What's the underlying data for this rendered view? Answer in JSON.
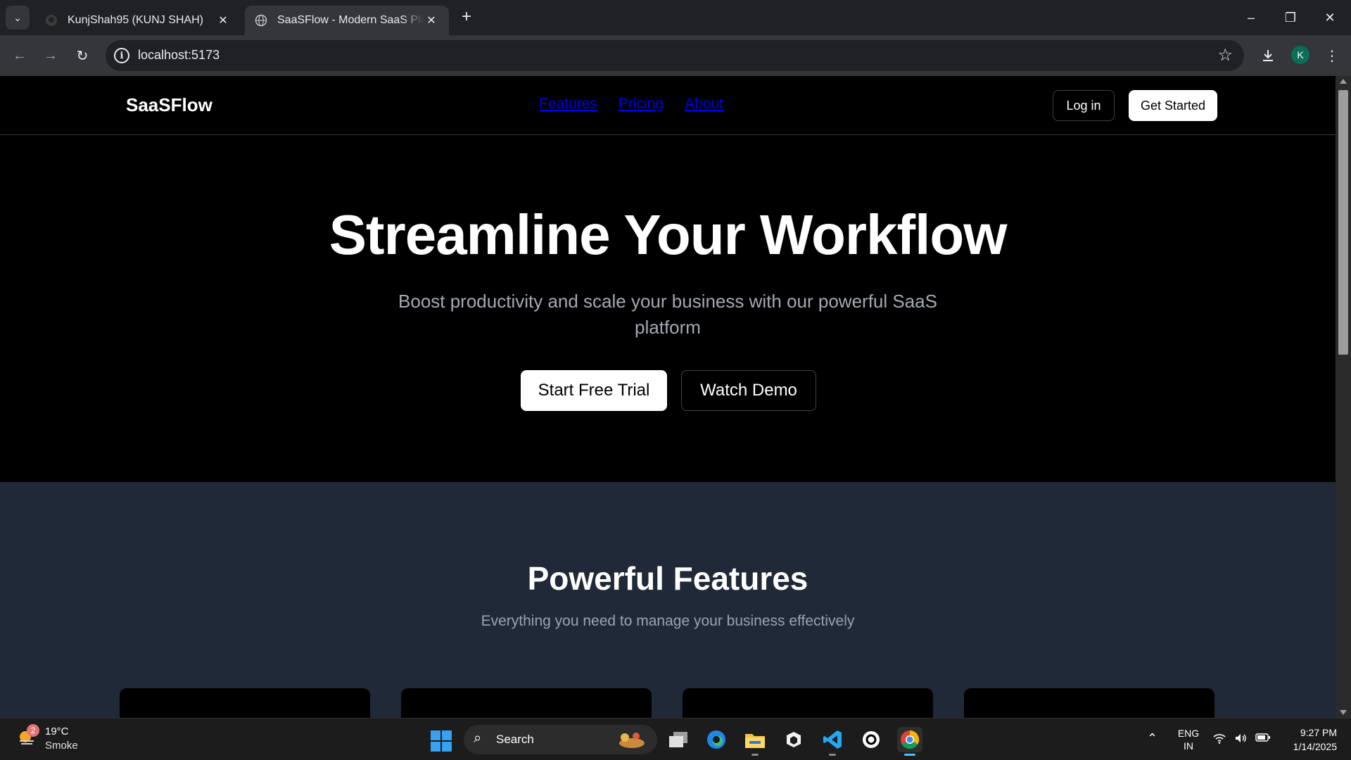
{
  "browser": {
    "tabs": [
      {
        "title": "KunjShah95 (KUNJ SHAH)",
        "favicon": "github-icon",
        "active": false
      },
      {
        "title": "SaaSFlow - Modern SaaS Platform",
        "favicon": "globe-icon",
        "active": true
      }
    ],
    "url": "localhost:5173",
    "profile_initial": "K"
  },
  "site": {
    "logo": "SaaSFlow",
    "nav": [
      "Features",
      "Pricing",
      "About"
    ],
    "login_label": "Log in",
    "get_started_label": "Get Started"
  },
  "hero": {
    "title": "Streamline Your Workflow",
    "subtitle": "Boost productivity and scale your business with our powerful SaaS platform",
    "primary_cta": "Start Free Trial",
    "secondary_cta": "Watch Demo"
  },
  "features": {
    "title": "Powerful Features",
    "subtitle": "Everything you need to manage your business effectively",
    "card_count_visible": 4
  },
  "taskbar": {
    "weather": {
      "temp": "19°C",
      "condition": "Smoke",
      "badge": "2"
    },
    "search_placeholder": "Search",
    "apps": [
      "task-view-icon",
      "edge-icon",
      "file-explorer-icon",
      "app-icon",
      "vscode-icon",
      "threads-icon",
      "chrome-icon"
    ],
    "lang": {
      "line1": "ENG",
      "line2": "IN"
    },
    "clock": {
      "time": "9:27 PM",
      "date": "1/14/2025"
    }
  },
  "colors": {
    "page_bg": "#000000",
    "features_bg": "#1f2937",
    "link": "#0000ee",
    "muted_text": "#a3a9b4"
  }
}
